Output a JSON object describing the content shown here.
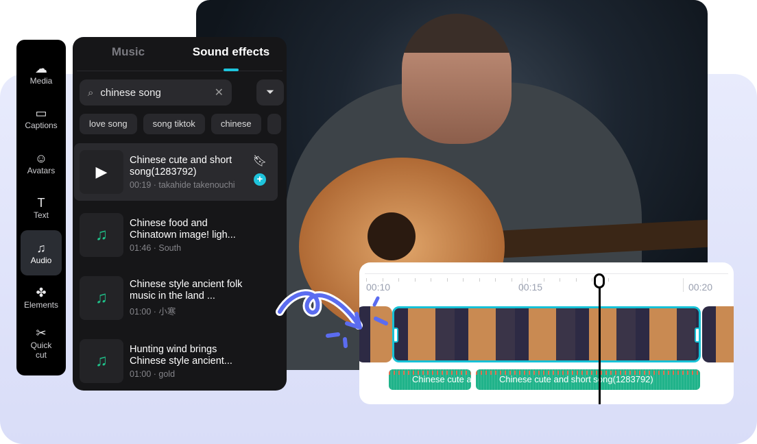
{
  "sidebar": {
    "items": [
      {
        "label": "Media",
        "icon": "cloud-upload-icon",
        "glyph": "☁"
      },
      {
        "label": "Captions",
        "icon": "captions-icon",
        "glyph": "▭"
      },
      {
        "label": "Avatars",
        "icon": "avatar-icon",
        "glyph": "☺"
      },
      {
        "label": "Text",
        "icon": "text-icon",
        "glyph": "T"
      },
      {
        "label": "Audio",
        "icon": "music-note-icon",
        "glyph": "♫",
        "active": true
      },
      {
        "label": "Elements",
        "icon": "elements-icon",
        "glyph": "✤"
      },
      {
        "label": "Quick cut",
        "icon": "scissors-icon",
        "glyph": "✂"
      }
    ]
  },
  "panel": {
    "tabs": [
      {
        "label": "Music"
      },
      {
        "label": "Sound effects",
        "active": true
      }
    ],
    "search": {
      "value": "chinese song"
    },
    "chips": [
      "love song",
      "song tiktok",
      "chinese"
    ],
    "items": [
      {
        "title": "Chinese cute and short song(1283792)",
        "sub": "00:19 · takahide takenouchi",
        "selected": true
      },
      {
        "title": "Chinese food and Chinatown image! ligh...",
        "sub": "01:46 · South"
      },
      {
        "title": "Chinese style ancient folk music in the land ...",
        "sub": "01:00 · 小寒"
      },
      {
        "title": "Hunting wind brings Chinese style ancient...",
        "sub": "01:00 · gold"
      }
    ]
  },
  "timeline": {
    "ticks": [
      "00:10",
      "00:15",
      "00:20"
    ],
    "audio_clips": [
      "Chinese cute a",
      "Chinese cute and short song(1283792)"
    ]
  },
  "colors": {
    "accent": "#1ec4dc",
    "audio": "#20b38a",
    "background": "#dfe3fb"
  }
}
